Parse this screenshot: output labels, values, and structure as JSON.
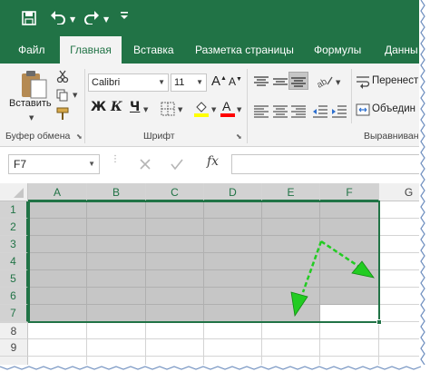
{
  "tabs": [
    {
      "label": "Файл"
    },
    {
      "label": "Главная"
    },
    {
      "label": "Вставка"
    },
    {
      "label": "Разметка страницы"
    },
    {
      "label": "Формулы"
    },
    {
      "label": "Данны"
    }
  ],
  "clipboard": {
    "paste_label": "Вставить",
    "group_label": "Буфер обмена"
  },
  "font": {
    "family": "Calibri",
    "size": "11",
    "bold": "Ж",
    "italic": "К",
    "underline": "Ч",
    "grow": "A",
    "shrink": "A",
    "group_label": "Шрифт"
  },
  "alignment": {
    "wrap_label": "Перенест",
    "merge_label": "Объедин",
    "group_label": "Выравниван"
  },
  "formula_bar": {
    "name_box": "F7",
    "fx": "fx",
    "value": ""
  },
  "grid": {
    "columns": [
      "A",
      "B",
      "C",
      "D",
      "E",
      "F",
      "G"
    ],
    "rows": [
      "1",
      "2",
      "3",
      "4",
      "5",
      "6",
      "7",
      "8",
      "9"
    ],
    "selected_range": "A1:F7"
  },
  "colors": {
    "accent": "#217346",
    "arrow": "#22cc22",
    "highlight_fill": "#ffff00",
    "font_color": "#ff0000"
  }
}
